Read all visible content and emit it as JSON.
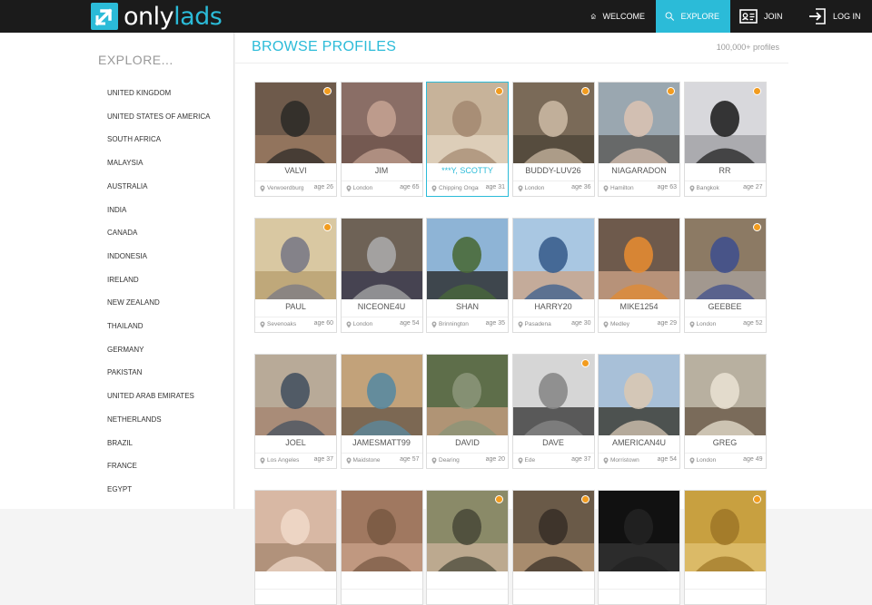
{
  "brand": {
    "name_part1": "only",
    "name_part2": "lads",
    "accent": "#2bbbd8"
  },
  "nav": [
    {
      "label": "WELCOME",
      "icon": "home-icon"
    },
    {
      "label": "EXPLORE",
      "icon": "search-icon",
      "active": true
    },
    {
      "label": "JOIN",
      "icon": "id-card-icon"
    },
    {
      "label": "LOG IN",
      "icon": "login-icon"
    }
  ],
  "sidebar": {
    "title": "EXPLORE...",
    "countries": [
      "UNITED KINGDOM",
      "UNITED STATES OF AMERICA",
      "SOUTH AFRICA",
      "MALAYSIA",
      "AUSTRALIA",
      "INDIA",
      "CANADA",
      "INDONESIA",
      "IRELAND",
      "NEW ZEALAND",
      "THAILAND",
      "GERMANY",
      "PAKISTAN",
      "UNITED ARAB EMIRATES",
      "NETHERLANDS",
      "BRAZIL",
      "FRANCE",
      "EGYPT"
    ]
  },
  "main": {
    "title": "BROWSE PROFILES",
    "count": "100,000+ profiles"
  },
  "online_color": "#f29c1f",
  "profiles": [
    {
      "name": "VALVI",
      "location": "Verwoerdburg",
      "age": "age 26",
      "online": true,
      "highlighted": false
    },
    {
      "name": "JIM",
      "location": "London",
      "age": "age 65",
      "online": false,
      "highlighted": false
    },
    {
      "name": "***Y, SCOTTY",
      "location": "Chipping Ongar",
      "age": "age 31",
      "online": true,
      "highlighted": true
    },
    {
      "name": "BUDDY-LUV26",
      "location": "London",
      "age": "age 36",
      "online": true,
      "highlighted": false
    },
    {
      "name": "NIAGARADON",
      "location": "Hamilton",
      "age": "age 63",
      "online": true,
      "highlighted": false
    },
    {
      "name": "RR",
      "location": "Bangkok",
      "age": "age 27",
      "online": true,
      "highlighted": false
    },
    {
      "name": "PAUL",
      "location": "Sevenoaks",
      "age": "age 60",
      "online": true,
      "highlighted": false
    },
    {
      "name": "NICEONE4U",
      "location": "London",
      "age": "age 54",
      "online": false,
      "highlighted": false
    },
    {
      "name": "SHAN",
      "location": "Brinnington",
      "age": "age 35",
      "online": false,
      "highlighted": false
    },
    {
      "name": "HARRY20",
      "location": "Pasadena",
      "age": "age 30",
      "online": false,
      "highlighted": false
    },
    {
      "name": "MIKE1254",
      "location": "Medley",
      "age": "age 29",
      "online": false,
      "highlighted": false
    },
    {
      "name": "GEEBEE",
      "location": "London",
      "age": "age 52",
      "online": true,
      "highlighted": false
    },
    {
      "name": "JOEL",
      "location": "Los Angeles",
      "age": "age 37",
      "online": false,
      "highlighted": false
    },
    {
      "name": "JAMESMATT99",
      "location": "Maidstone",
      "age": "age 57",
      "online": false,
      "highlighted": false
    },
    {
      "name": "DAVID",
      "location": "Dearing",
      "age": "age 20",
      "online": false,
      "highlighted": false
    },
    {
      "name": "DAVE",
      "location": "Ede",
      "age": "age 37",
      "online": true,
      "highlighted": false
    },
    {
      "name": "AMERICAN4U",
      "location": "Morristown",
      "age": "age 54",
      "online": false,
      "highlighted": false
    },
    {
      "name": "GREG",
      "location": "London",
      "age": "age 49",
      "online": false,
      "highlighted": false
    },
    {
      "name": "",
      "location": "",
      "age": "",
      "online": false,
      "highlighted": false
    },
    {
      "name": "",
      "location": "",
      "age": "",
      "online": false,
      "highlighted": false
    },
    {
      "name": "",
      "location": "",
      "age": "",
      "online": true,
      "highlighted": false
    },
    {
      "name": "",
      "location": "",
      "age": "",
      "online": true,
      "highlighted": false
    },
    {
      "name": "",
      "location": "",
      "age": "",
      "online": false,
      "highlighted": false
    },
    {
      "name": "",
      "location": "",
      "age": "",
      "online": true,
      "highlighted": false
    }
  ]
}
